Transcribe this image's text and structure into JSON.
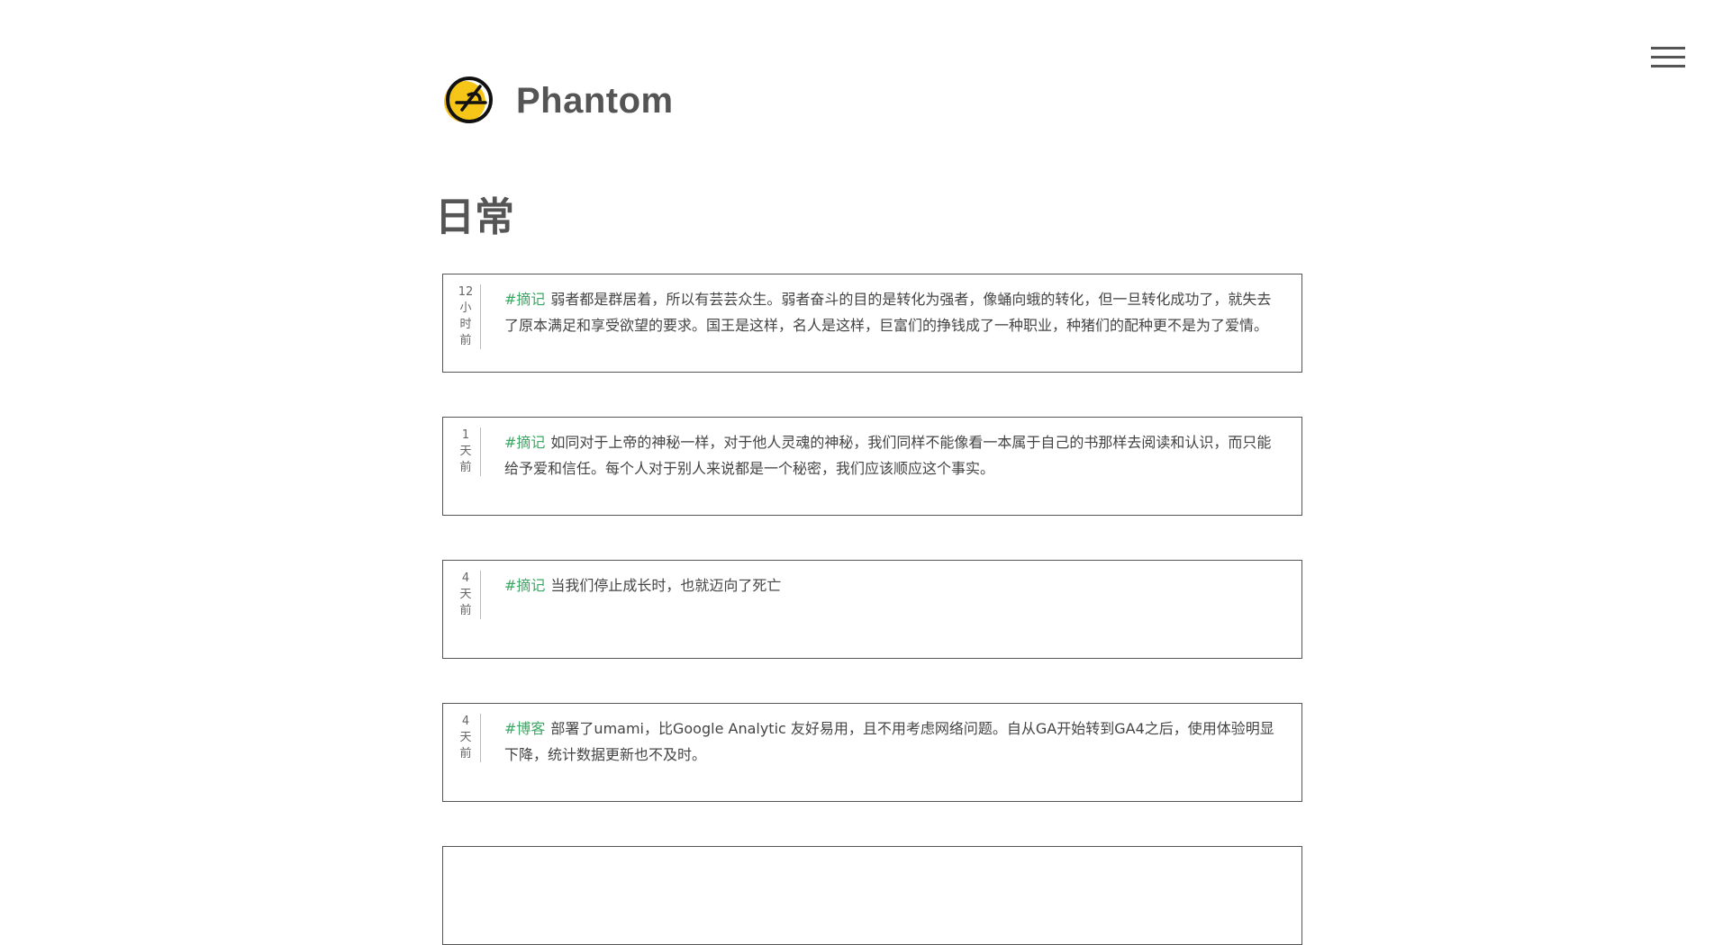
{
  "site": {
    "title": "Phantom",
    "logo_icon": "phantom-logo-icon",
    "menu_icon": "hamburger-menu-icon",
    "accent_color": "#3aa864",
    "logo_yellow": "#f5c518"
  },
  "page": {
    "title": "日常"
  },
  "posts": [
    {
      "time": [
        "12",
        "小",
        "时",
        "前"
      ],
      "tag": "#摘记",
      "text": "弱者都是群居着，所以有芸芸众生。弱者奋斗的目的是转化为强者，像蛹向蛾的转化，但一旦转化成功了，就失去了原本满足和享受欲望的要求。国王是这样，名人是这样，巨富们的挣钱成了一种职业，种猪们的配种更不是为了爱情。"
    },
    {
      "time": [
        "1",
        "天",
        "前"
      ],
      "tag": "#摘记",
      "text": "如同对于上帝的神秘一样，对于他人灵魂的神秘，我们同样不能像看一本属于自己的书那样去阅读和认识，而只能给予爱和信任。每个人对于别人来说都是一个秘密，我们应该顺应这个事实。"
    },
    {
      "time": [
        "4",
        "天",
        "前"
      ],
      "tag": "#摘记",
      "text": "当我们停止成长时，也就迈向了死亡"
    },
    {
      "time": [
        "4",
        "天",
        "前"
      ],
      "tag": "#博客",
      "text": "部署了umami，比Google Analytic 友好易用，且不用考虑网络问题。自从GA开始转到GA4之后，使用体验明显下降，统计数据更新也不及时。"
    }
  ]
}
